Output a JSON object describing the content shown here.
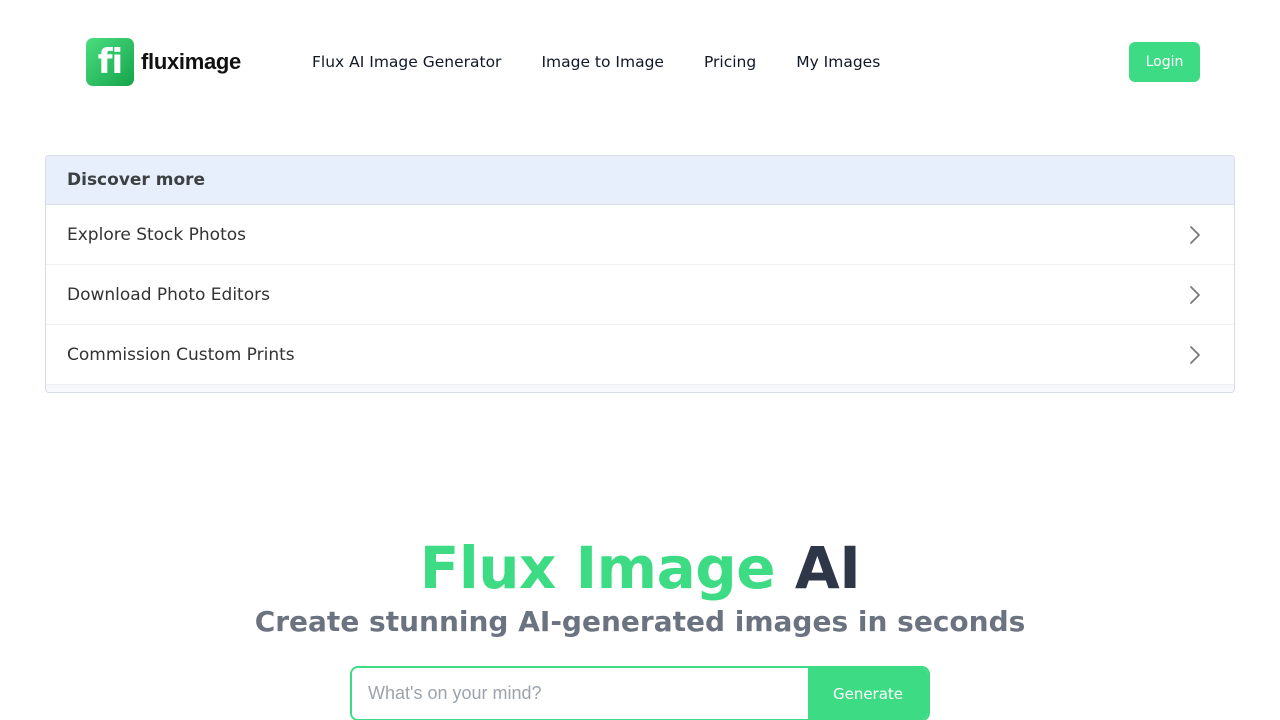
{
  "brand": {
    "logo_mark": "fi",
    "name": "fluximage",
    "accent_color": "#3ddc84"
  },
  "nav": {
    "items": [
      {
        "label": "Flux AI Image Generator"
      },
      {
        "label": "Image to Image"
      },
      {
        "label": "Pricing"
      },
      {
        "label": "My Images"
      }
    ],
    "login_label": "Login"
  },
  "discover": {
    "title": "Discover more",
    "items": [
      {
        "label": "Explore Stock Photos",
        "icon": "chevron-right-icon"
      },
      {
        "label": "Download Photo Editors",
        "icon": "chevron-right-icon"
      },
      {
        "label": "Commission Custom Prints",
        "icon": "chevron-right-icon"
      }
    ]
  },
  "hero": {
    "title_green": "Flux Image",
    "title_dark": "AI",
    "subtitle": "Create stunning AI-generated images in seconds",
    "prompt_placeholder": "What's on your mind?",
    "generate_label": "Generate"
  }
}
